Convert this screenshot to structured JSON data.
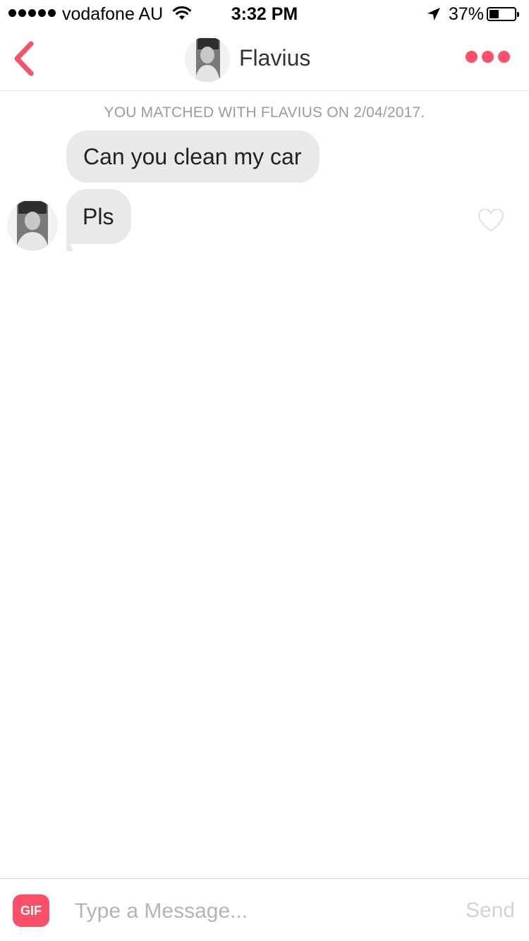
{
  "status_bar": {
    "carrier": "vodafone AU",
    "time": "3:32 PM",
    "battery_percent": "37%",
    "battery_level": 0.37,
    "signal_icon": "signal-dots-icon",
    "wifi_icon": "wifi-icon",
    "location_icon": "location-arrow-icon"
  },
  "header": {
    "back_icon": "chevron-left-icon",
    "contact_name": "Flavius",
    "more_icon": "more-dots-icon",
    "accent_color": "#fd5068"
  },
  "chat": {
    "match_notice": "YOU MATCHED WITH FLAVIUS ON 2/04/2017.",
    "messages": [
      {
        "text": "Can you clean my car"
      },
      {
        "text": "Pls"
      }
    ],
    "like_icon": "heart-outline-icon"
  },
  "composer": {
    "gif_label": "GIF",
    "input_value": "",
    "input_placeholder": "Type a Message...",
    "send_label": "Send"
  }
}
